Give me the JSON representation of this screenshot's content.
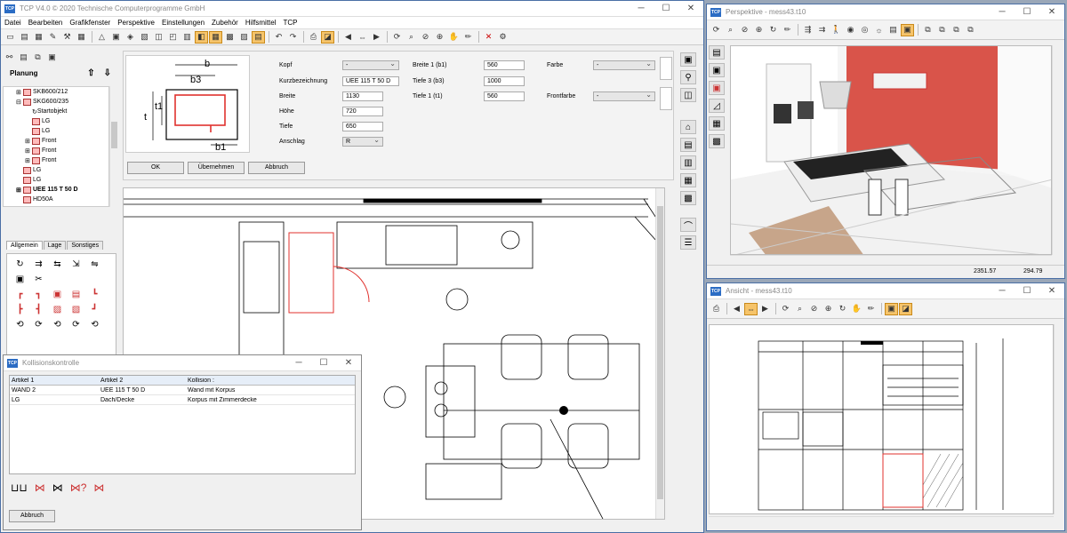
{
  "main_window": {
    "title": "TCP V4.0 © 2020 Technische Computerprogramme GmbH",
    "menu": [
      "Datei",
      "Bearbeiten",
      "Grafikfenster",
      "Perspektive",
      "Einstellungen",
      "Zubehör",
      "Hilfsmittel",
      "TCP"
    ]
  },
  "planung": {
    "title": "Planung",
    "tree": [
      {
        "label": "SKB600/212",
        "indent": 1,
        "icon": true,
        "expander": "+"
      },
      {
        "label": "SKG600/235",
        "indent": 1,
        "icon": true,
        "expander": "-"
      },
      {
        "label": "Startobjekt",
        "indent": 2,
        "icon": false,
        "expander": ""
      },
      {
        "label": "LG",
        "indent": 2,
        "icon": true,
        "expander": ""
      },
      {
        "label": "LG",
        "indent": 2,
        "icon": true,
        "expander": ""
      },
      {
        "label": "Front",
        "indent": 2,
        "icon": true,
        "expander": "+"
      },
      {
        "label": "Front",
        "indent": 2,
        "icon": true,
        "expander": "+"
      },
      {
        "label": "Front",
        "indent": 2,
        "icon": true,
        "expander": "+"
      },
      {
        "label": "LG",
        "indent": 1,
        "icon": true,
        "expander": ""
      },
      {
        "label": "LG",
        "indent": 1,
        "icon": true,
        "expander": ""
      },
      {
        "label": "UEE 115 T 50 D",
        "indent": 1,
        "icon": true,
        "expander": "+",
        "selected": true
      },
      {
        "label": "HD50A",
        "indent": 1,
        "icon": true,
        "expander": ""
      }
    ],
    "tabs": [
      "Allgemein",
      "Lage",
      "Sonstiges"
    ]
  },
  "props": {
    "dim_labels": {
      "b": "b",
      "b3": "b3",
      "t": "t",
      "t1": "t1",
      "b1": "b1"
    },
    "kopf_label": "Kopf",
    "kopf_value": "-",
    "kurz_label": "Kurzbezeichnung",
    "kurz_value": "UEE 115 T 50 D",
    "breite_label": "Breite",
    "breite_value": "1130",
    "hoehe_label": "Höhe",
    "hoehe_value": "720",
    "tiefe_label": "Tiefe",
    "tiefe_value": "650",
    "anschlag_label": "Anschlag",
    "anschlag_value": "R",
    "breite1_label": "Breite 1 (b1)",
    "breite1_value": "560",
    "tiefe3_label": "Tiefe 3 (b3)",
    "tiefe3_value": "1000",
    "tiefe1_label": "Tiefe 1 (t1)",
    "tiefe1_value": "560",
    "farbe_label": "Farbe",
    "farbe_value": "-",
    "frontfarbe_label": "Frontfarbe",
    "frontfarbe_value": "-",
    "ok": "OK",
    "uebernehmen": "Übernehmen",
    "abbruch": "Abbruch"
  },
  "kollision": {
    "title": "Kollisionskontrolle",
    "headers": [
      "Artikel 1",
      "Artikel 2",
      "Kollision :"
    ],
    "rows": [
      [
        "WAND 2",
        "UEE 115 T 50 D",
        "Wand mit Korpus"
      ],
      [
        "LG",
        "Dach/Decke",
        "Korpus mit Zimmerdecke"
      ]
    ],
    "abbruch": "Abbruch"
  },
  "perspektive": {
    "title": "Perspektive - mess43.t10",
    "status_x": "2351.57",
    "status_y": "294.79"
  },
  "ansicht": {
    "title": "Ansicht - mess43.t10"
  },
  "colors": {
    "accent": "#f6c46a",
    "wall": "#d9544a",
    "selection": "#e0322e"
  }
}
